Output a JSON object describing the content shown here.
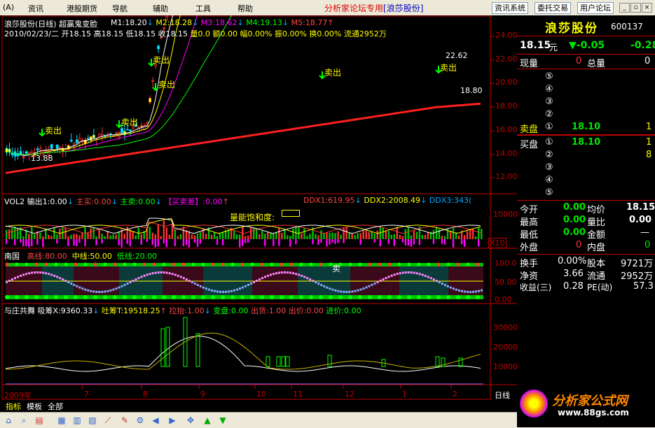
{
  "menubar": {
    "items": [
      "(A)",
      "资讯",
      "港股期货",
      "导航",
      "辅助",
      "工具",
      "帮助"
    ],
    "brand": "分析家论坛专用",
    "brand_stock": "[浪莎股份]",
    "buttons": [
      "资讯系统",
      "委托交易",
      "用户论坛"
    ]
  },
  "colors": {
    "up": "#ff3232",
    "down": "#00e600",
    "bg": "#000000",
    "axis": "#c00000",
    "price": "#ffffff"
  },
  "kpanel": {
    "title": "浪莎股份(日线)",
    "formula": "超赢鬼变脸",
    "ma": [
      {
        "label": "M1:18.20",
        "color": "#ffffff"
      },
      {
        "label": "M2:18.28",
        "color": "#ffff00"
      },
      {
        "label": "M3:18.62",
        "color": "#ff00ff"
      },
      {
        "label": "M4:19.13",
        "color": "#00ff00"
      },
      {
        "label": "M5:18.77",
        "color": "#ff4040"
      }
    ],
    "info": "2010/02/23/二 开18.15 高18.15 低18.15 收18.15",
    "info2": "量0.0 额0.00 幅0.00% 振0.00% 换0.00% 流通2952万",
    "yticks": [
      "24.00",
      "22.00",
      "20.00",
      "18.00",
      "16.00",
      "14.00",
      "12.00"
    ],
    "hi": "22.62",
    "lo": "13.88",
    "last": "18.80",
    "sell_label": "卖出"
  },
  "volpanel": {
    "title": "VOL2 输出1:0.00",
    "zhumai": "主买:0.00",
    "zhumai2": "主卖:0.00",
    "maimaicha": "【买卖差】:0.00",
    "ddx1": "DDX1:619.95",
    "ddx2": "DDX2:2008.49",
    "ddx3": "DDX3:343(",
    "bubble": "量能饱和度:",
    "ytick": "10000",
    "scale": "X10"
  },
  "nanguo": {
    "title": "南国",
    "high": "高线:80.00",
    "mid": "中线:50.00",
    "low": "低线:20.00",
    "yticks": [
      "100.0",
      "50.00",
      "0.00"
    ],
    "sell": "卖"
  },
  "zhuang": {
    "title": "与庄共舞",
    "xi": "吸筹X:9360.33",
    "tu": "吐筹T:19518.25",
    "la": "拉抬:1.00",
    "bian": "变盘:0.00",
    "chu": "出货:1.00",
    "chujia": "出价:0.00",
    "jinjia": "进价:0.00",
    "yticks": [
      "30000",
      "20000",
      "10000"
    ]
  },
  "xaxis": {
    "labels": [
      "2009年",
      "7",
      "8",
      "9",
      "10",
      "11",
      "12",
      "1",
      "2"
    ],
    "period": "日线"
  },
  "quote": {
    "name": "浪莎股份",
    "code": "600137",
    "price": "18.15",
    "unit": "元",
    "change": "▼-0.05",
    "pct": "-0.28",
    "xianliang_label": "现量",
    "xianliang": "0",
    "zongliang_label": "总量",
    "zongliang": "0",
    "sell_levels": [
      "⑤",
      "④",
      "③",
      "②"
    ],
    "sell1_label": "卖盘",
    "sell1_idx": "①",
    "sell1_price": "18.10",
    "sell1_vol": "1",
    "buy1_label": "买盘",
    "buy1_idx": "①",
    "buy1_price": "18.10",
    "buy1_vol": "1",
    "buy_levels": [
      {
        "idx": "②",
        "vol": "8"
      },
      {
        "idx": "③",
        "vol": ""
      },
      {
        "idx": "④",
        "vol": ""
      },
      {
        "idx": "⑤",
        "vol": ""
      }
    ],
    "stats": [
      {
        "l1": "今开",
        "v1": "0.00",
        "l2": "均价",
        "v2": "18.15",
        "c1": "#00e600",
        "c2": "#ffffff"
      },
      {
        "l1": "最高",
        "v1": "0.00",
        "l2": "量比",
        "v2": "0.00",
        "c1": "#00e600",
        "c2": "#ffffff"
      },
      {
        "l1": "最低",
        "v1": "0.00",
        "l2": "金额",
        "v2": "—",
        "c1": "#00e600",
        "c2": "#ffffff"
      },
      {
        "l1": "外盘",
        "v1": "0",
        "l2": "内盘",
        "v2": "0",
        "c1": "#ff3232",
        "c2": "#00e600"
      }
    ],
    "stats2": [
      {
        "l1": "换手",
        "v1": "0.00%",
        "l2": "股本",
        "v2": "9721万"
      },
      {
        "l1": "净资",
        "v1": "3.66",
        "l2": "流通",
        "v2": "2952万"
      },
      {
        "l1": "收益(三)",
        "v1": "0.28",
        "l2": "PE(动)",
        "v2": "57.3"
      }
    ]
  },
  "bottom": {
    "tabs": [
      "指标",
      "模板",
      "全部"
    ]
  },
  "logo": {
    "text": "分析家公式网",
    "url": "www.88gs.com"
  }
}
